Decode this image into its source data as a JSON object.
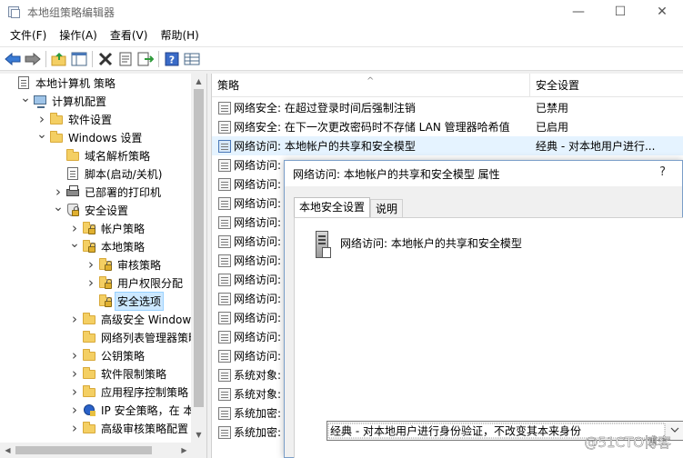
{
  "window": {
    "title": "本地组策略编辑器",
    "controls": [
      "—",
      "☐",
      "✕"
    ]
  },
  "menu": [
    "文件(F)",
    "操作(A)",
    "查看(V)",
    "帮助(H)"
  ],
  "tree": {
    "items": [
      {
        "label": "本地计算机 策略",
        "icon": "policy-icon",
        "depth": 0,
        "expander": ""
      },
      {
        "label": "计算机配置",
        "icon": "computer-icon",
        "depth": 1,
        "expander": "v"
      },
      {
        "label": "软件设置",
        "icon": "folder-icon",
        "depth": 2,
        "expander": ">"
      },
      {
        "label": "Windows 设置",
        "icon": "folder-icon",
        "depth": 2,
        "expander": "v"
      },
      {
        "label": "域名解析策略",
        "icon": "folder-icon",
        "depth": 3,
        "expander": ""
      },
      {
        "label": "脚本(启动/关机)",
        "icon": "policy-icon",
        "depth": 3,
        "expander": ""
      },
      {
        "label": "已部署的打印机",
        "icon": "printer-icon",
        "depth": 3,
        "expander": ">"
      },
      {
        "label": "安全设置",
        "icon": "shield-icon",
        "depth": 3,
        "expander": "v"
      },
      {
        "label": "帐户策略",
        "icon": "folder-lock-icon",
        "depth": 4,
        "expander": ">"
      },
      {
        "label": "本地策略",
        "icon": "folder-lock-icon",
        "depth": 4,
        "expander": "v"
      },
      {
        "label": "审核策略",
        "icon": "folder-lock-icon",
        "depth": 5,
        "expander": ">"
      },
      {
        "label": "用户权限分配",
        "icon": "folder-lock-icon",
        "depth": 5,
        "expander": ">"
      },
      {
        "label": "安全选项",
        "icon": "folder-lock-icon",
        "depth": 5,
        "expander": "",
        "selected": true
      },
      {
        "label": "高级安全 Windows",
        "icon": "folder-icon",
        "depth": 4,
        "expander": ">"
      },
      {
        "label": "网络列表管理器策略",
        "icon": "folder-icon",
        "depth": 4,
        "expander": ""
      },
      {
        "label": "公钥策略",
        "icon": "folder-icon",
        "depth": 4,
        "expander": ">"
      },
      {
        "label": "软件限制策略",
        "icon": "folder-icon",
        "depth": 4,
        "expander": ">"
      },
      {
        "label": "应用程序控制策略",
        "icon": "folder-icon",
        "depth": 4,
        "expander": ">"
      },
      {
        "label": "IP 安全策略，在 本",
        "icon": "ipsec-icon",
        "depth": 4,
        "expander": ">"
      },
      {
        "label": "高级审核策略配置",
        "icon": "folder-icon",
        "depth": 4,
        "expander": ">"
      }
    ]
  },
  "list": {
    "headers": {
      "policy": "策略",
      "setting": "安全设置"
    },
    "rows": [
      {
        "name": "网络安全: 在超过登录时间后强制注销",
        "value": "已禁用"
      },
      {
        "name": "网络安全: 在下一次更改密码时不存储 LAN 管理器哈希值",
        "value": "已启用"
      },
      {
        "name": "网络访问: 本地帐户的共享和安全模型",
        "value": "经典 - 对本地用户进行...",
        "highlight": true
      },
      {
        "name": "网络访问:",
        "value": ""
      },
      {
        "name": "网络访问:",
        "value": ""
      },
      {
        "name": "网络访问:",
        "value": ""
      },
      {
        "name": "网络访问:",
        "value": ""
      },
      {
        "name": "网络访问:",
        "value": ""
      },
      {
        "name": "网络访问:",
        "value": ""
      },
      {
        "name": "网络访问:",
        "value": ""
      },
      {
        "name": "网络访问:",
        "value": ""
      },
      {
        "name": "网络访问:",
        "value": ""
      },
      {
        "name": "网络访问:",
        "value": ""
      },
      {
        "name": "网络访问:",
        "value": ""
      },
      {
        "name": "系统对象:",
        "value": ""
      },
      {
        "name": "系统对象:",
        "value": ""
      },
      {
        "name": "系统加密:",
        "value": ""
      },
      {
        "name": "系统加密:",
        "value": ""
      }
    ]
  },
  "dialog": {
    "title": "网络访问: 本地帐户的共享和安全模型 属性",
    "help": "?",
    "tabs": [
      "本地安全设置",
      "说明"
    ],
    "policy_name": "网络访问: 本地帐户的共享和安全模型",
    "select_value": "经典 - 对本地用户进行身份验证，不改变其本来身份"
  },
  "watermark": "@51CTO博客"
}
